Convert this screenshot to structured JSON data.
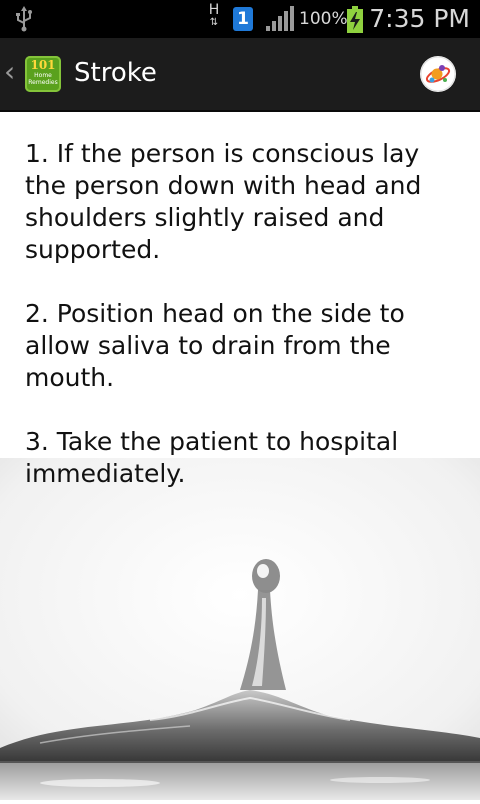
{
  "status_bar": {
    "net_type": "H",
    "notification_count": "1",
    "battery_percent": "100%",
    "time": "7:35 PM"
  },
  "action_bar": {
    "title": "Stroke",
    "logo_number": "101",
    "logo_text_line1": "Home",
    "logo_text_line2": "Remedies"
  },
  "content": {
    "steps": [
      "1. If the person is conscious lay the person down with head and shoulders slightly raised and supported.",
      "2. Position head on the side to allow saliva to drain from the mouth.",
      "3. Take the patient to hospital immediately."
    ]
  },
  "icons": {
    "usb": "usb-icon",
    "signal": "signal-icon",
    "battery": "battery-charging-icon",
    "back": "chevron-left-icon",
    "share": "share-app-icon"
  },
  "colors": {
    "status_bar": "#000000",
    "action_bar": "#1c1c1c",
    "notification_badge": "#1f79d8",
    "battery_charging": "#8fd13f",
    "logo_green": "#5aa11d"
  }
}
